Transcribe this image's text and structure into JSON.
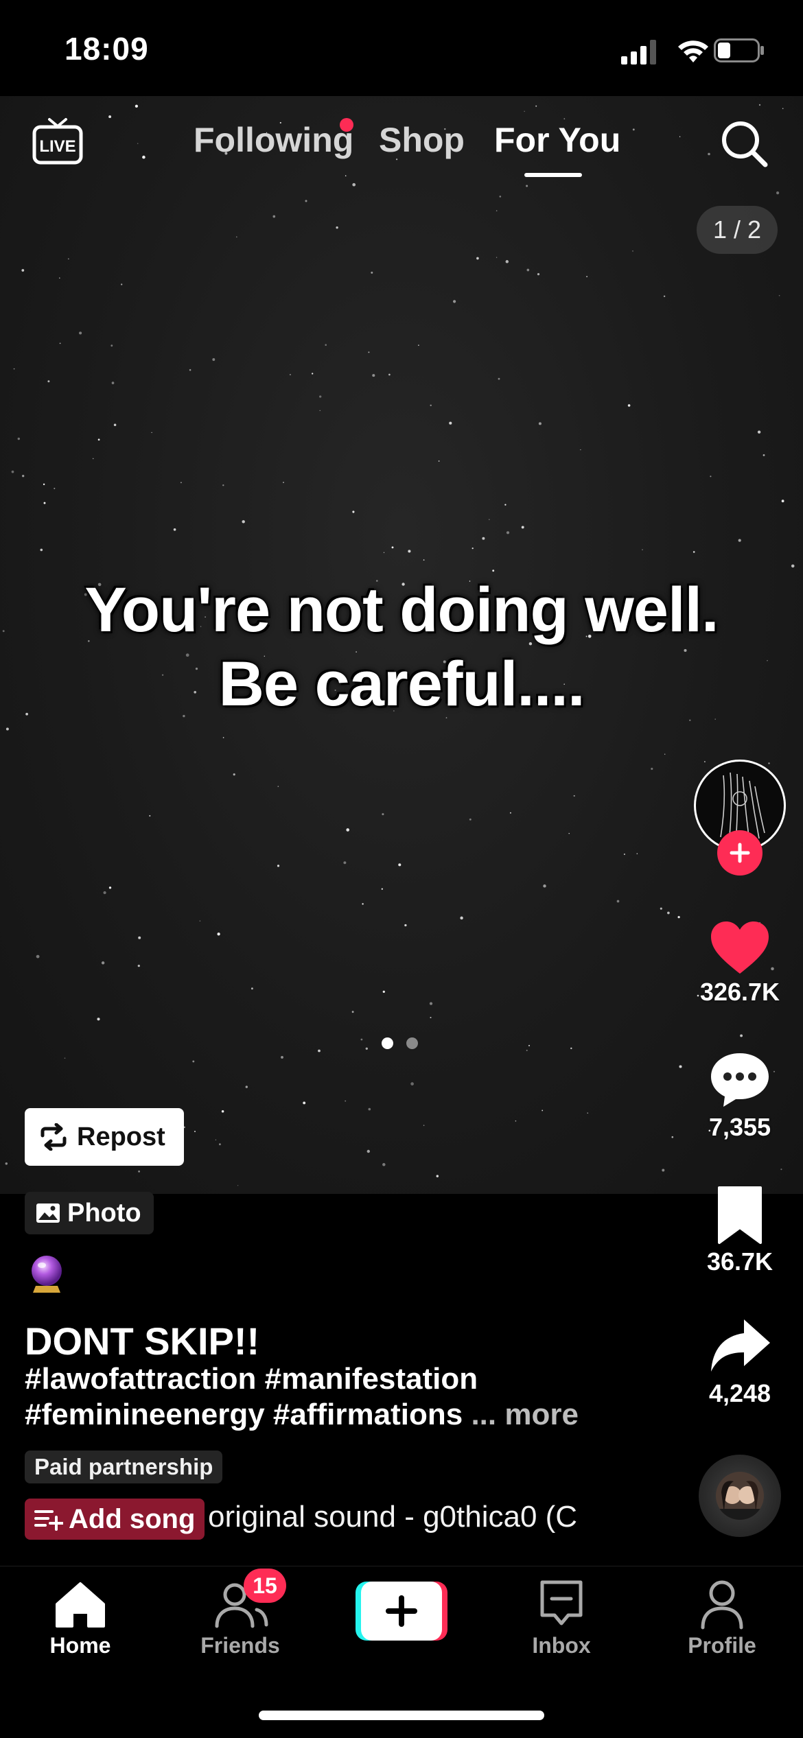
{
  "status_bar": {
    "time": "18:09"
  },
  "top_nav": {
    "live_icon": "live-tv-icon",
    "tabs": [
      {
        "label": "Following",
        "has_dot": true
      },
      {
        "label": "Shop"
      },
      {
        "label": "For You",
        "active": true
      }
    ],
    "search_icon": "search-icon"
  },
  "post": {
    "page_counter": "1 / 2",
    "overlay_text": [
      "You're not doing well.",
      "Be careful...."
    ],
    "carousel": {
      "count": 2,
      "active_index": 0
    },
    "repost_label": "Repost",
    "media_type_label": "Photo",
    "title": "DONT SKIP!!",
    "hashtags_line1": "#lawofattraction #manifestation",
    "hashtags_line2": "#feminineenergy #affirmations",
    "more_label": "... more",
    "paid_partnership_label": "Paid partnership",
    "add_song_label": "Add song",
    "sound_name": "original sound - g0thica0 (C"
  },
  "actions": {
    "likes": "326.7K",
    "comments": "7,355",
    "bookmarks": "36.7K",
    "shares": "4,248"
  },
  "bottom_nav": {
    "items": [
      {
        "label": "Home",
        "icon": "home-icon",
        "active": true
      },
      {
        "label": "Friends",
        "icon": "friends-icon",
        "badge": "15"
      },
      {
        "label": "",
        "icon": "create-plus-icon"
      },
      {
        "label": "Inbox",
        "icon": "inbox-icon"
      },
      {
        "label": "Profile",
        "icon": "profile-icon"
      }
    ]
  },
  "colors": {
    "accent": "#fe2c55",
    "background": "#000000",
    "create_cyan": "#25f4ee"
  }
}
